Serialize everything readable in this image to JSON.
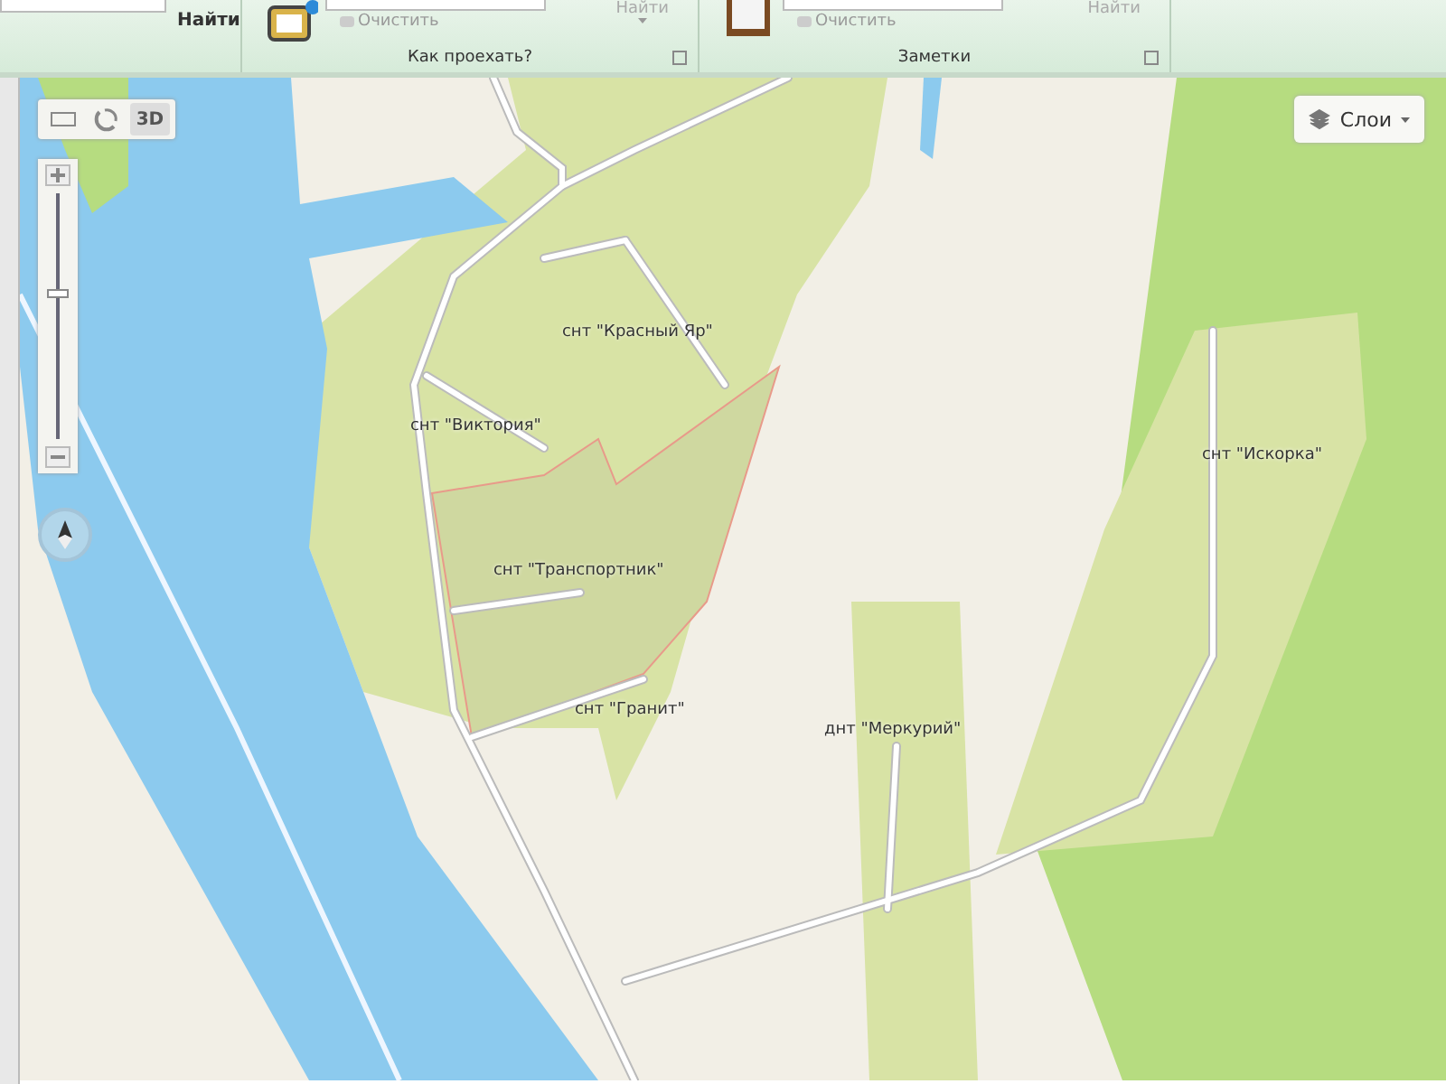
{
  "ribbon": {
    "groups": [
      {
        "kind": "search",
        "buttons": [
          {
            "label": "Найти",
            "disabled": false
          }
        ]
      },
      {
        "kind": "route",
        "clear": "Очистить",
        "find": {
          "label": "Найти",
          "disabled": true
        },
        "title": "Как проехать?"
      },
      {
        "kind": "notes",
        "clear": "Очистить",
        "find": {
          "label": "Найти",
          "disabled": true
        },
        "title": "Заметки"
      }
    ]
  },
  "map": {
    "tools": [
      {
        "kind": "ruler",
        "selected": false
      },
      {
        "kind": "traffic",
        "selected": false
      },
      {
        "kind": "perspective",
        "label": "3D",
        "selected": true
      }
    ],
    "zoom": {
      "level": 0.59
    },
    "layers_button": {
      "label": "Слои"
    },
    "places": [
      {
        "label": "снт \"Красный Яр\""
      },
      {
        "label": "снт \"Виктория\""
      },
      {
        "label": "снт \"Транспортник\""
      },
      {
        "label": "снт \"Гранит\""
      },
      {
        "label": "днт \"Меркурий\""
      },
      {
        "label": "снт \"Искорка\""
      }
    ]
  }
}
